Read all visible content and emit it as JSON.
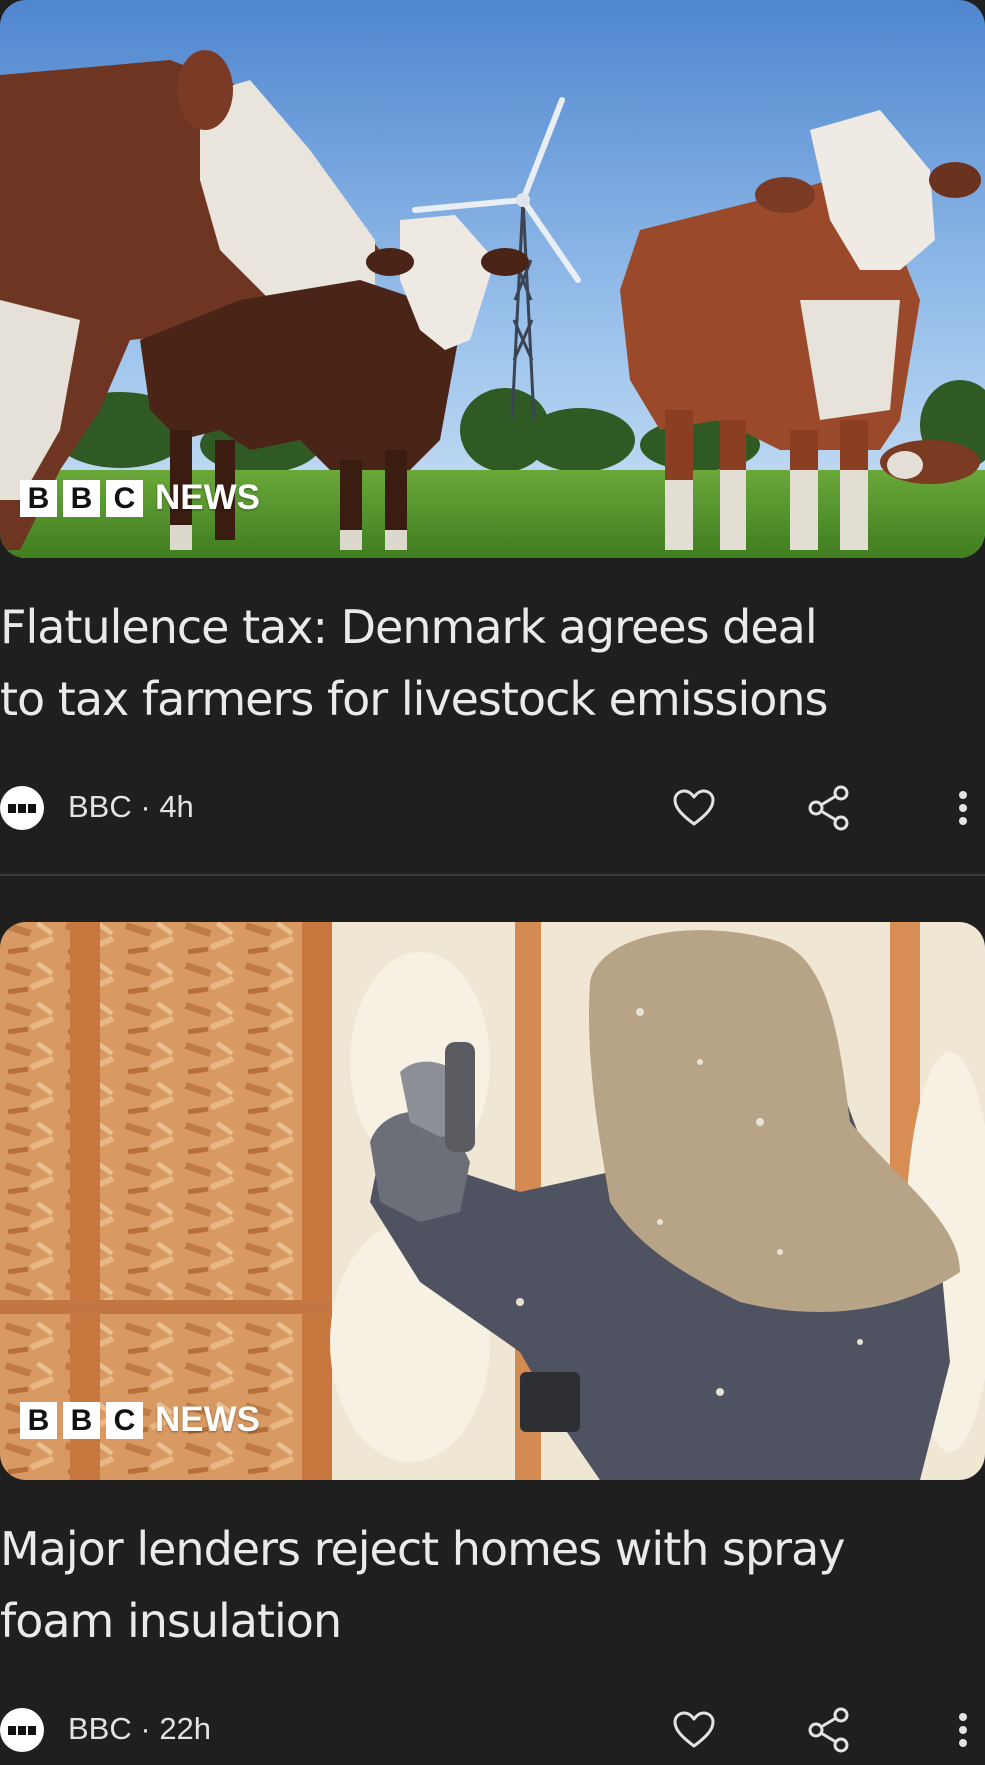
{
  "feed": {
    "articles": [
      {
        "image_badge": {
          "letters": [
            "B",
            "B",
            "C"
          ],
          "label": "NEWS"
        },
        "headline": "Flatulence tax: Denmark agrees deal\nto tax farmers for livestock emissions",
        "source": "BBC",
        "time": "4h"
      },
      {
        "image_badge": {
          "letters": [
            "B",
            "B",
            "C"
          ],
          "label": "NEWS"
        },
        "headline": "Major lenders reject homes with spray\nfoam insulation",
        "source": "BBC",
        "time": "22h"
      }
    ]
  },
  "icons": {
    "like": "heart-icon",
    "share": "share-icon",
    "more": "more-vertical-icon",
    "source_logo": "bbc-logo-icon"
  },
  "colors": {
    "background": "#1f1f1f",
    "text": "#eaeaea",
    "divider": "#3a3a3a"
  }
}
